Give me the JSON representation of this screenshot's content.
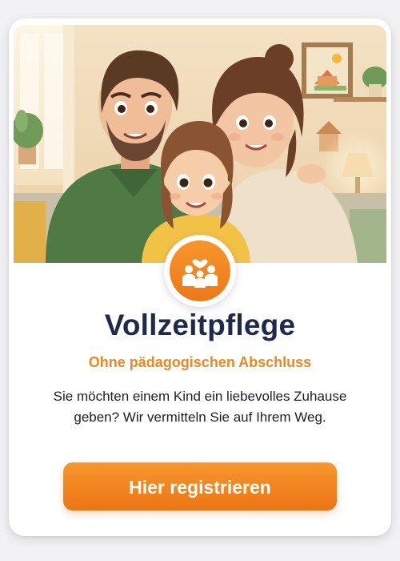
{
  "card": {
    "title": "Vollzeitpflege",
    "subtitle": "Ohne pädagogischen Abschluss",
    "description": "Sie möchten einem Kind ein liebevolles Zuhause geben? Wir vermitteln Sie auf Ihrem Weg.",
    "cta_label": "Hier registrieren"
  },
  "icons": {
    "badge": "family-heart-icon"
  },
  "colors": {
    "accent": "#F08A22",
    "title": "#1D2A4A",
    "text": "#1E1E24",
    "card_background": "#FFFFFF"
  }
}
